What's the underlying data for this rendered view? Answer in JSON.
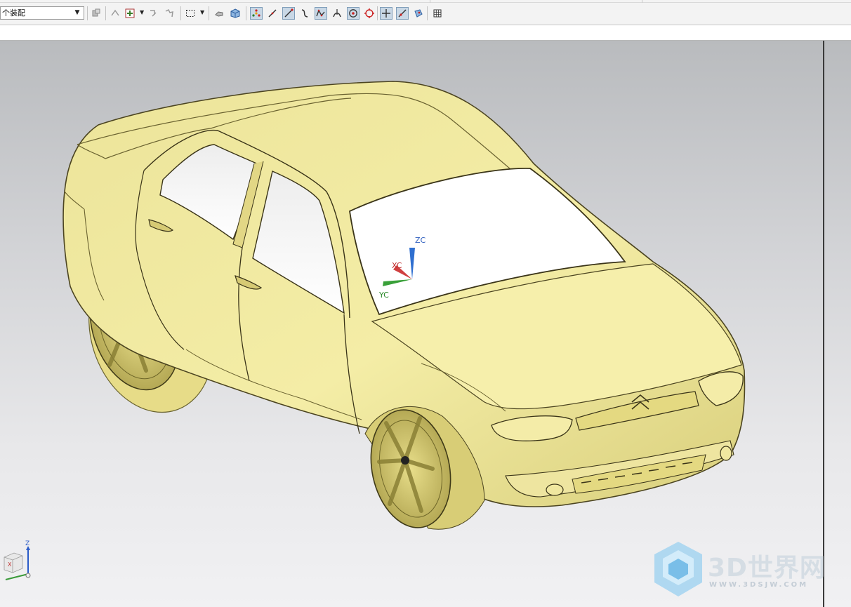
{
  "toolbar": {
    "assembly_select": {
      "value": "个装配"
    },
    "buttons": [
      {
        "name": "component-icon",
        "active": false
      },
      {
        "name": "move-icon",
        "active": false
      },
      {
        "name": "add-icon",
        "active": false
      },
      {
        "name": "transform-icon",
        "active": false
      },
      {
        "name": "snap-icon",
        "active": false
      },
      {
        "name": "select-box-icon",
        "active": false
      },
      {
        "name": "shaded-view-icon",
        "active": false
      },
      {
        "name": "solid-view-icon",
        "active": false
      },
      {
        "name": "snap-point-icon",
        "active": true
      },
      {
        "name": "line-icon",
        "active": false
      },
      {
        "name": "line-endpoint-icon",
        "active": true
      },
      {
        "name": "curve-icon",
        "active": false
      },
      {
        "name": "spline-icon",
        "active": true
      },
      {
        "name": "tangent-icon",
        "active": false
      },
      {
        "name": "center-point-icon",
        "active": true
      },
      {
        "name": "quadrant-icon",
        "active": false
      },
      {
        "name": "crosshair-icon",
        "active": true
      },
      {
        "name": "point-on-curve-icon",
        "active": true
      },
      {
        "name": "face-icon",
        "active": false
      },
      {
        "name": "grid-icon",
        "active": false
      }
    ]
  },
  "viewport": {
    "wcs": {
      "zc": "ZC",
      "xc": "XC",
      "yc": "YC"
    },
    "view_triad": {
      "z": "Z",
      "x": "X"
    },
    "model_color": "#f2ea9c"
  },
  "watermark": {
    "title": "3D世界网",
    "url": "WWW.3DSJW.COM"
  }
}
